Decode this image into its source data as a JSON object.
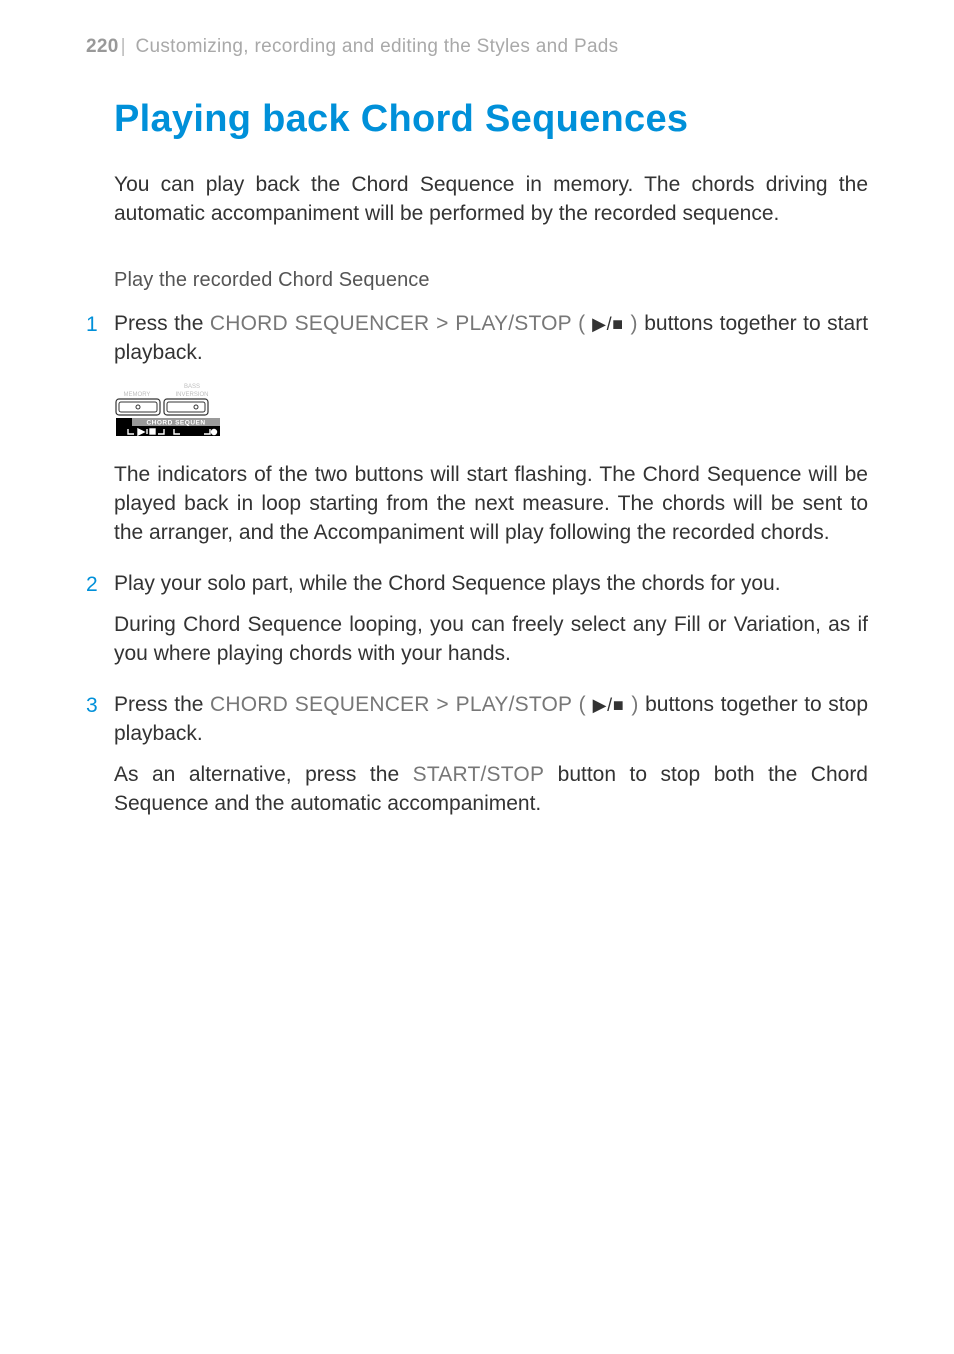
{
  "header": {
    "page_number": "220",
    "divider": "|",
    "section": "Customizing, recording and editing the Styles and Pads"
  },
  "title": "Playing back Chord Sequences",
  "intro": "You can play back the Chord Sequence in memory. The chords driving the automatic accompaniment will be performed by the recorded sequence.",
  "subhead": "Play the recorded Chord Sequence",
  "ui_strings": {
    "chord_seq_playstop": "CHORD SEQUENCER > PLAY/STOP ( ",
    "playstop_close": " )",
    "start_stop": "START/STOP"
  },
  "glyphs": {
    "play_stop": "▶/■"
  },
  "steps": {
    "s1": {
      "num": "1",
      "pre": "Press the ",
      "post": " buttons together to start playback."
    },
    "s2": {
      "num": "2",
      "text": "Play your solo part, while the Chord Sequence plays the chords for you."
    },
    "s3": {
      "num": "3",
      "pre": "Press the ",
      "post": " buttons together to stop playback."
    }
  },
  "paragraphs": {
    "p1": "The indicators of the two buttons will start flashing. The Chord Sequence will be played back in loop starting from the next measure. The chords will be sent to the arranger, and the Accompaniment will play following the recorded chords.",
    "p2": "During Chord Sequence looping, you can freely select any Fill or Variation, as if you where playing chords with your hands.",
    "p3_pre": "As an alternative, press the ",
    "p3_post": " button to stop both the Chord Sequence and the automatic accompaniment."
  },
  "illustration": {
    "label_top": "BASS",
    "label_left": "MEMORY",
    "label_right": "INVERSION",
    "banner": "CHORD SEQUEN"
  }
}
